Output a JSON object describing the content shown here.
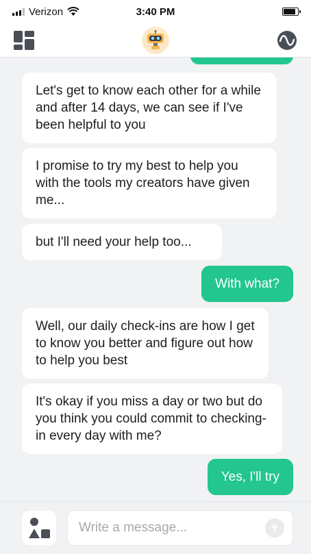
{
  "status_bar": {
    "carrier": "Verizon",
    "time": "3:40 PM",
    "icons": [
      "signal-icon",
      "wifi-icon",
      "battery-icon"
    ]
  },
  "nav_bar": {
    "left_icon": "dashboard-icon",
    "center_icon": "robot-avatar-icon",
    "right_icon": "wave-icon"
  },
  "messages": [
    {
      "sender": "bot",
      "text": "Let's get to know each other for a while and after 14 days, we can see if I've been helpful to you"
    },
    {
      "sender": "bot",
      "text": "I promise to try my best to help you with the tools my creators have given me..."
    },
    {
      "sender": "bot",
      "text": "but I'll need your help too..."
    },
    {
      "sender": "user",
      "text": "With what?"
    },
    {
      "sender": "bot",
      "text": "Well, our daily check-ins are how I get to know you better and figure out how to help you best"
    },
    {
      "sender": "bot",
      "text": "It's okay if you miss a day or two but do you think you could commit to checking-in every day with me?"
    },
    {
      "sender": "user",
      "text": "Yes, I'll try"
    }
  ],
  "composer": {
    "placeholder": "Write a message...",
    "value": "",
    "attach_icon": "shapes-icon",
    "send_icon": "arrow-up-icon"
  },
  "colors": {
    "accent": "#22c68e",
    "background": "#f1f2f4",
    "bot_bubble": "#ffffff"
  }
}
